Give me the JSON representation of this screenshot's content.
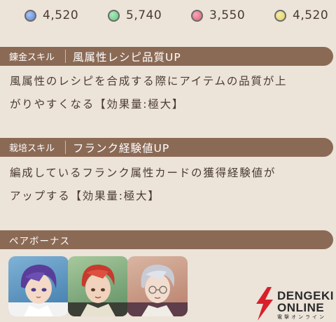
{
  "resources": [
    {
      "icon": "blue-orb-icon",
      "color": "#5f86d6",
      "value": "4,520"
    },
    {
      "icon": "green-orb-icon",
      "color": "#5fc97a",
      "value": "5,740"
    },
    {
      "icon": "red-orb-icon",
      "color": "#e0607a",
      "value": "3,550"
    },
    {
      "icon": "yellow-orb-icon",
      "color": "#e0cf5a",
      "value": "4,520"
    }
  ],
  "skills": [
    {
      "type": "錬金スキル",
      "name": "風属性レシピ品質UP",
      "desc_line1": "風属性のレシピを合成する際にアイテムの品質が上",
      "desc_line2": "がりやすくなる【効果量:極大】"
    },
    {
      "type": "栽培スキル",
      "name": "フランク経験値UP",
      "desc_line1": "編成しているフランク属性カードの獲得経験値が",
      "desc_line2": "アップする【効果量:極大】"
    }
  ],
  "pair_bonus": {
    "label": "ペアボーナス",
    "portraits": [
      "purple-haired-character-icon",
      "red-haired-character-icon",
      "silver-haired-character-icon"
    ]
  },
  "watermark": {
    "line1": "DENGEKI",
    "line2": "ONLINE",
    "sub": "電撃オンライン"
  },
  "colors": {
    "bar": "#8b6a55",
    "background": "#ece3d9",
    "text": "#4a3b33"
  }
}
